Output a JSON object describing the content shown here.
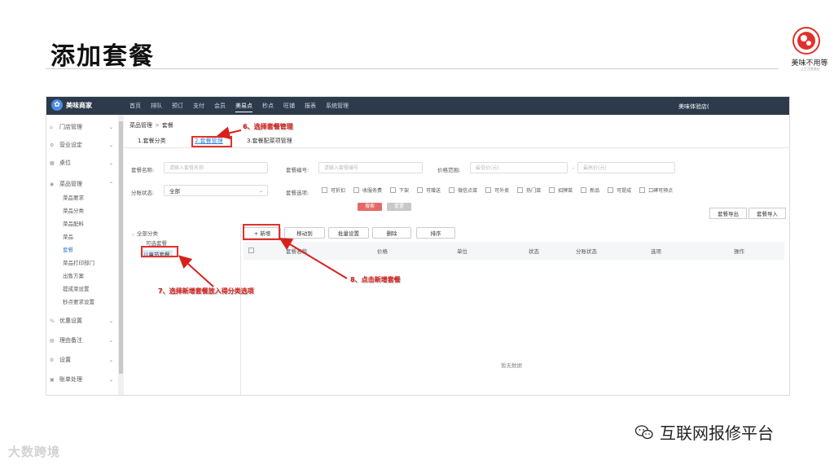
{
  "slide": {
    "title": "添加套餐",
    "brand": "美味不用等",
    "brand_sub": "让生活更美好",
    "watermark": "大数跨境",
    "wechat_account": "互联网报修平台"
  },
  "app": {
    "logo": "美味商家",
    "nav": [
      "首页",
      "排队",
      "预订",
      "支付",
      "会员",
      "美易点",
      "秒点",
      "旺铺",
      "报表",
      "系统管理"
    ],
    "active_nav": "美易点",
    "store": "美味体验店(",
    "sidebar": {
      "groups": [
        {
          "label": "门店管理",
          "icon": "store-icon"
        },
        {
          "label": "营业设定",
          "icon": "settings-icon"
        },
        {
          "label": "桌位",
          "icon": "table-icon"
        },
        {
          "label": "菜品管理",
          "icon": "dish-icon"
        },
        {
          "label": "优惠设置",
          "icon": "discount-icon"
        },
        {
          "label": "理由备注",
          "icon": "note-icon"
        },
        {
          "label": "设置",
          "icon": "gear-icon"
        },
        {
          "label": "账单处理",
          "icon": "bill-icon"
        }
      ],
      "sub_items": [
        "菜品要求",
        "菜品分类",
        "菜品配料",
        "菜品",
        "套餐",
        "菜品打印部门",
        "出售方案",
        "提成菜设置",
        "秒点要求设置"
      ],
      "active_sub": "套餐"
    },
    "breadcrumb": [
      "菜品管理",
      "套餐"
    ],
    "tabs": [
      "1.套餐分类",
      "2.套餐管理",
      "3.套餐配菜项管理"
    ],
    "active_tab": "2.套餐管理",
    "filters": {
      "name_label": "套餐名称:",
      "name_placeholder": "请输入套餐名称",
      "code_label": "套餐编号:",
      "code_placeholder": "请输入套餐编号",
      "price_label": "价格范围:",
      "price_min_placeholder": "最低价(元)",
      "price_sep": "-",
      "price_max_placeholder": "最高价(元)",
      "status_label": "分账状态:",
      "status_value": "全部",
      "options_label": "套餐选项:",
      "options": [
        "可折扣",
        "收服务费",
        "下架",
        "可赠送",
        "微信点菜",
        "可外卖",
        "热门菜",
        "招牌菜",
        "新品",
        "可提成",
        "口碑可预点"
      ]
    },
    "search_button": "搜索",
    "reset_button": "重置",
    "export_button": "套餐导出",
    "import_button": "套餐导入",
    "tree": {
      "root": "全部分类",
      "items": [
        "可选套餐",
        "儿童节套餐"
      ]
    },
    "toolbar": {
      "add": "+ 新增",
      "move": "移动到",
      "batch": "批量设置",
      "delete": "删除",
      "sort": "排序"
    },
    "columns": [
      "套餐名称",
      "价格",
      "单位",
      "状态",
      "分账状态",
      "选项",
      "操作"
    ],
    "empty_text": "暂无数据"
  },
  "annotations": {
    "step6": "6、选择套餐管理",
    "step7": "7、选择新增套餐放入得分类选项",
    "step8": "8、点击新增套餐"
  },
  "colors": {
    "topbar": "#2d3a4b",
    "accent": "#2f7fd8",
    "search": "#e26a66",
    "annotation": "#d8201c"
  }
}
